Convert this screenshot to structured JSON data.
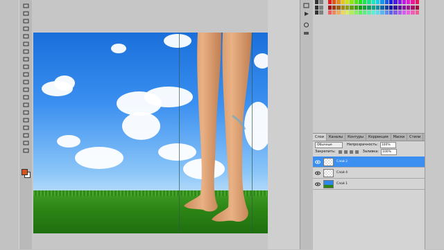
{
  "toolbar": {
    "tools": [
      "move-icon",
      "marquee-icon",
      "lasso-icon",
      "magic-wand-icon",
      "crop-icon",
      "eyedropper-icon",
      "healing-icon",
      "brush-icon",
      "clone-stamp-icon",
      "history-brush-icon",
      "eraser-icon",
      "gradient-icon",
      "blur-icon",
      "dodge-icon",
      "pen-icon",
      "type-icon",
      "path-select-icon",
      "shape-icon",
      "hand-icon",
      "zoom-icon"
    ],
    "foreground_color": "#d9531e",
    "background_color": "#ffffff"
  },
  "canvas": {
    "sky_color": "#2f86eb",
    "grass_color": "#2c8515"
  },
  "layers_panel": {
    "tabs": [
      "Слои",
      "Каналы",
      "Контуры",
      "Коррекция",
      "Маски",
      "Стили"
    ],
    "blend_mode": "Обычные",
    "opacity_label": "Непрозрачность:",
    "opacity_value": "100%",
    "lock_label": "Закрепить:",
    "fill_label": "Заливка:",
    "fill_value": "100%",
    "layers": [
      {
        "name": "Слой 2",
        "selected": true
      },
      {
        "name": "Слой 4",
        "selected": false
      },
      {
        "name": "Слой 1",
        "selected": false
      }
    ]
  }
}
